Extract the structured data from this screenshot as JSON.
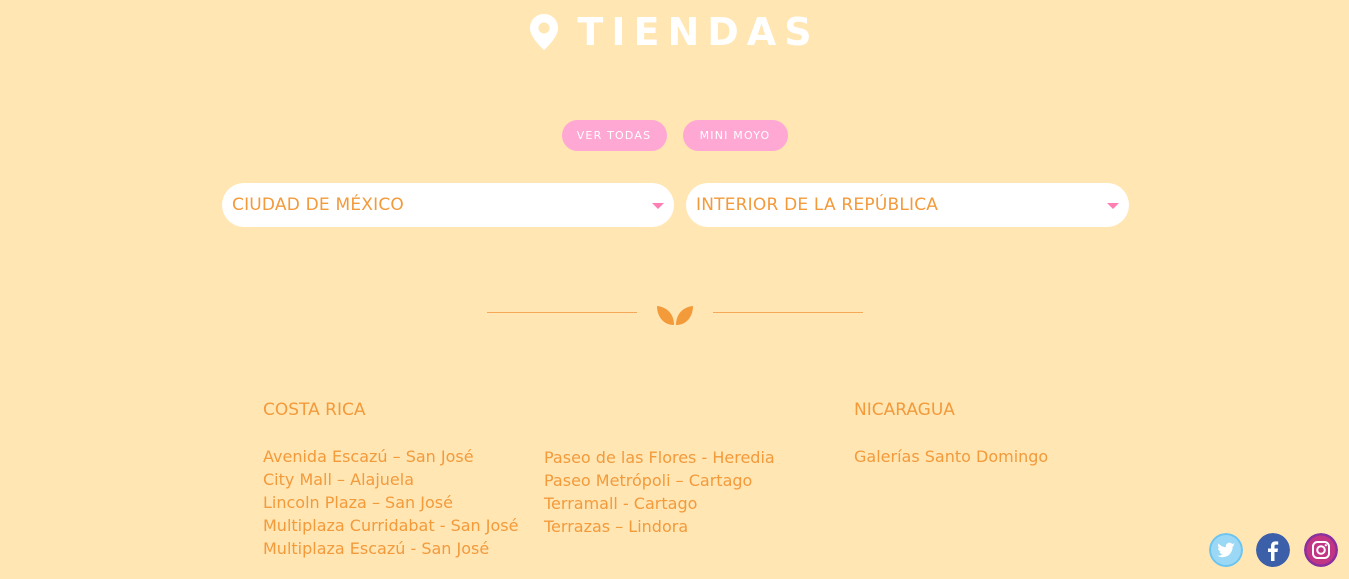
{
  "header": {
    "title": "TIENDAS",
    "icon": "map-pin-icon"
  },
  "filters": {
    "all_label": "VER TODAS",
    "mini_label": "MINI MOYO"
  },
  "selects": {
    "cdmx_label": "CIUDAD DE MÉXICO",
    "interior_label": "INTERIOR DE LA REPÚBLICA"
  },
  "divider": {
    "icon": "leaf-icon"
  },
  "costa_rica": {
    "title": "COSTA RICA",
    "col1": [
      "Avenida Escazú – San José",
      "City Mall – Alajuela",
      "Lincoln Plaza – San José",
      "Multiplaza Curridabat - San José",
      "Multiplaza Escazú - San José"
    ],
    "col2": [
      "Paseo de las Flores - Heredia",
      "Paseo Metrópoli – Cartago",
      "Terramall - Cartago",
      "Terrazas – Lindora"
    ]
  },
  "nicaragua": {
    "title": "NICARAGUA",
    "stores": [
      "Galerías Santo Domingo"
    ]
  },
  "social": [
    "twitter-icon",
    "facebook-icon",
    "instagram-icon"
  ],
  "colors": {
    "background": "#ffe6b3",
    "accent": "#f39a3b",
    "pill": "#ffa8d4",
    "caret": "#ff7fb3"
  }
}
